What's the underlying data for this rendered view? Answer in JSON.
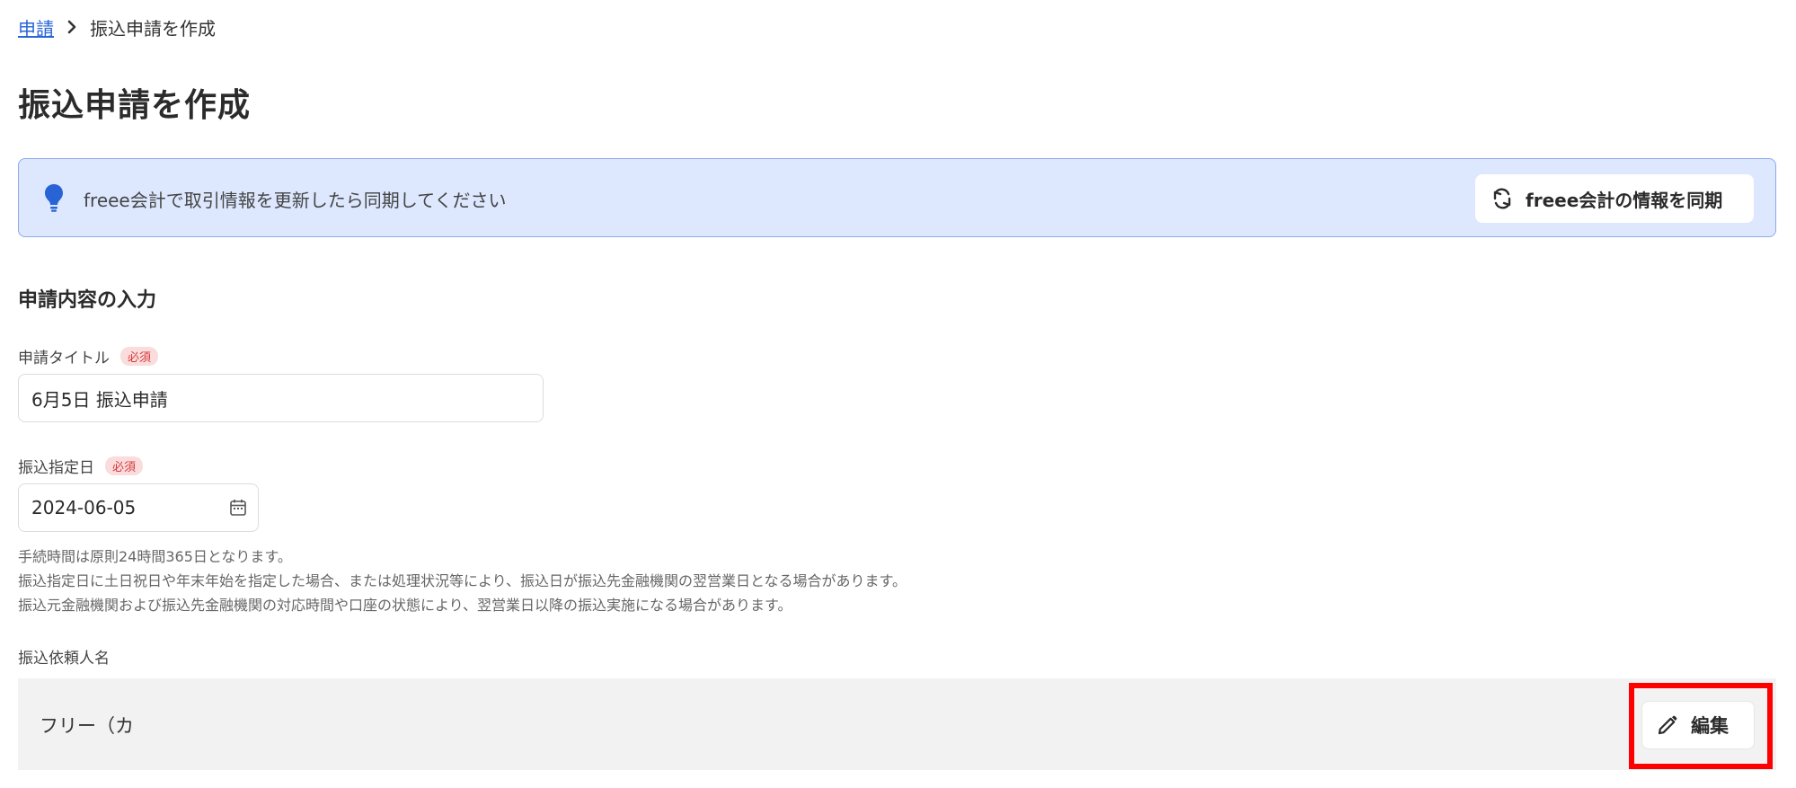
{
  "breadcrumb": {
    "parent": "申請",
    "current": "振込申請を作成"
  },
  "page_title": "振込申請を作成",
  "banner": {
    "message": "freee会計で取引情報を更新したら同期してください",
    "sync_button_label": "freee会計の情報を同期",
    "icon": "lightbulb-icon",
    "background": "#dde8ff"
  },
  "form": {
    "section_title": "申請内容の入力",
    "title_field": {
      "label": "申請タイトル",
      "required_badge": "必須",
      "value": "6月5日 振込申請"
    },
    "date_field": {
      "label": "振込指定日",
      "required_badge": "必須",
      "value": "2024-06-05",
      "icon": "calendar-icon"
    },
    "help_lines": [
      "手続時間は原則24時間365日となります。",
      "振込指定日に土日祝日や年末年始を指定した場合、または処理状況等により、振込日が振込先金融機関の翌営業日となる場合があります。",
      "振込元金融機関および振込先金融機関の対応時間や口座の状態により、翌営業日以降の振込実施になる場合があります。"
    ],
    "requester": {
      "label": "振込依頼人名",
      "value": "フリー（カ",
      "edit_button_label": "編集",
      "icon": "pencil-icon"
    }
  },
  "colors": {
    "link": "#2864d6",
    "required_badge_bg": "#fadcdc",
    "required_badge_text": "#d63b3b",
    "highlight": "#ff0000"
  }
}
